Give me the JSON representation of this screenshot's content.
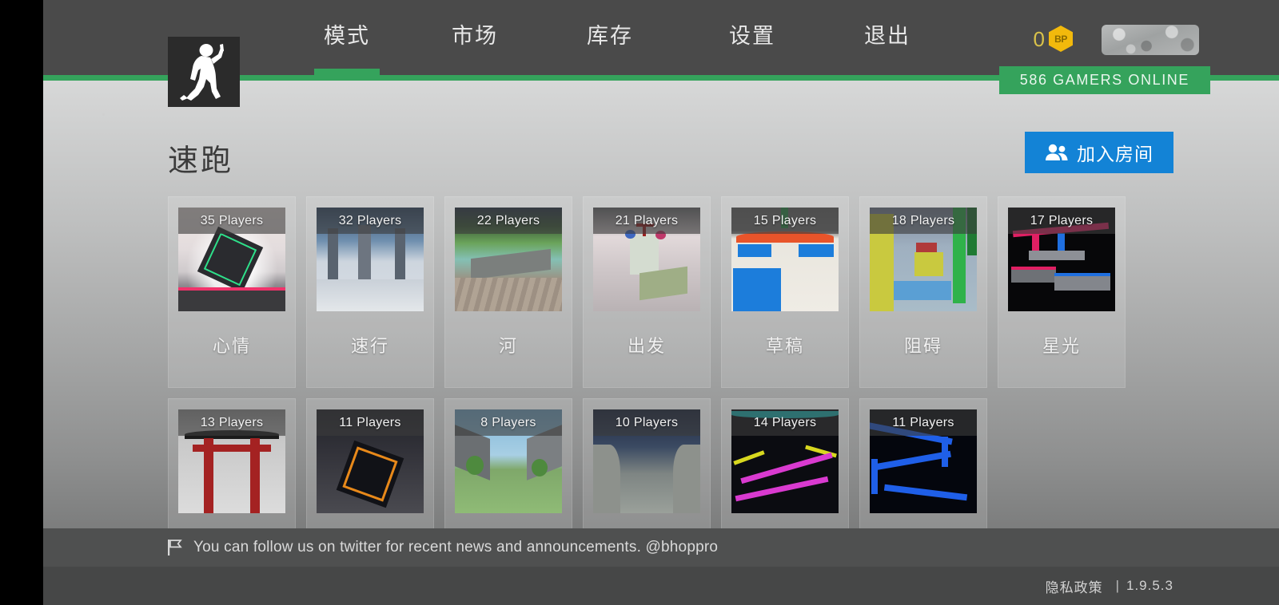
{
  "nav": {
    "logo_icon": "running-man-icon",
    "items": [
      {
        "label": "模式",
        "active": true
      },
      {
        "label": "市场",
        "active": false
      },
      {
        "label": "库存",
        "active": false
      },
      {
        "label": "设置",
        "active": false
      },
      {
        "label": "退出",
        "active": false
      }
    ],
    "currency": {
      "amount": "0",
      "badge_label": "BP",
      "badge_color": "#f2b90c"
    },
    "online_banner": "586 GAMERS ONLINE",
    "online_banner_color": "#35a35c",
    "accent_color": "#35a35c"
  },
  "page": {
    "title": "速跑",
    "join_button": {
      "label": "加入房间",
      "icon": "people-icon",
      "color": "#1383d6"
    },
    "players_suffix": "Players"
  },
  "maps": [
    {
      "name": "心情",
      "players": "35 Players",
      "style": "mood"
    },
    {
      "name": "速行",
      "players": "32 Players",
      "style": "hallway"
    },
    {
      "name": "河",
      "players": "22 Players",
      "style": "river"
    },
    {
      "name": "出发",
      "players": "21 Players",
      "style": "start"
    },
    {
      "name": "草稿",
      "players": "15 Players",
      "style": "draft"
    },
    {
      "name": "阻碍",
      "players": "18 Players",
      "style": "block"
    },
    {
      "name": "星光",
      "players": "17 Players",
      "style": "starlight"
    },
    {
      "name": "",
      "players": "13 Players",
      "style": "torii"
    },
    {
      "name": "",
      "players": "11 Players",
      "style": "orangecube"
    },
    {
      "name": "",
      "players": "8 Players",
      "style": "trees"
    },
    {
      "name": "",
      "players": "10 Players",
      "style": "tunnel"
    },
    {
      "name": "",
      "players": "14 Players",
      "style": "neonpink"
    },
    {
      "name": "",
      "players": "11 Players",
      "style": "neonblue"
    }
  ],
  "footer": {
    "announcement_icon": "flag-icon",
    "announcement": "You can follow us on twitter for recent news and announcements. @bhoppro",
    "privacy_label": "隐私政策",
    "separator": "|",
    "version": "1.9.5.3"
  }
}
